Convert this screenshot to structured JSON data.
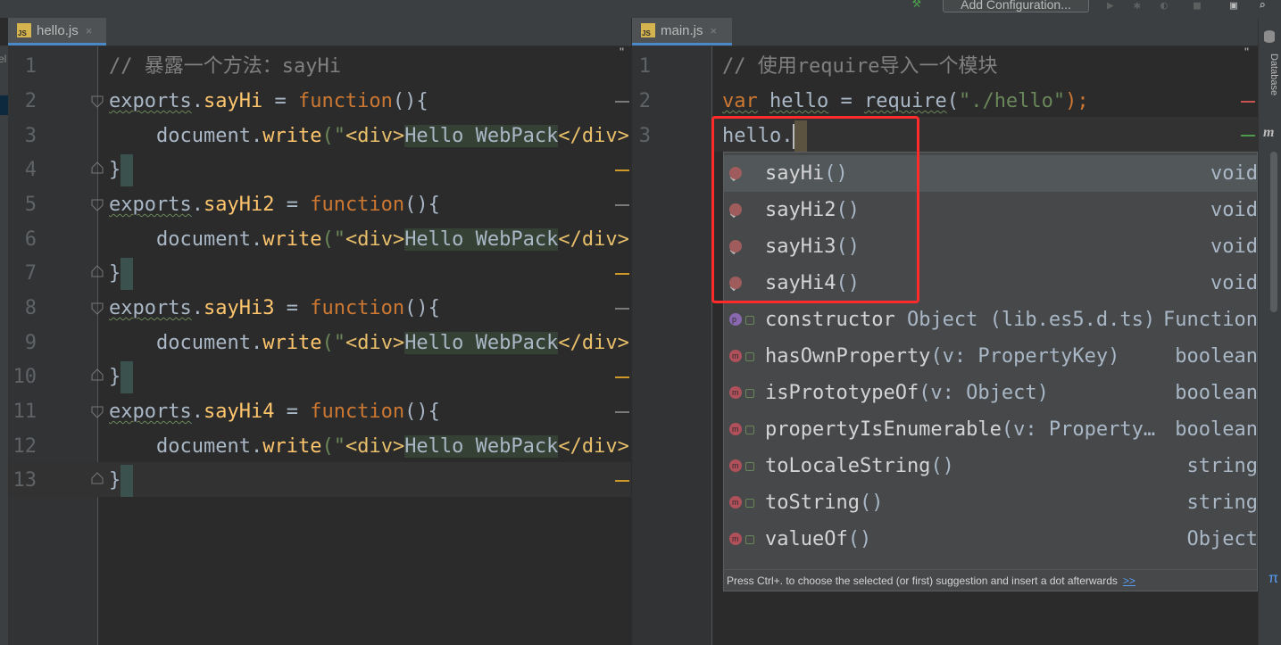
{
  "toolbar": {
    "add_configuration_label": "Add Configuration..."
  },
  "left_panel": {
    "label": "el"
  },
  "left_editor": {
    "tab": {
      "label": "hello.js",
      "icon": "js-file-icon",
      "close": "×"
    },
    "line_numbers": [
      "1",
      "2",
      "3",
      "4",
      "5",
      "6",
      "7",
      "8",
      "9",
      "10",
      "11",
      "12",
      "13"
    ],
    "lines": [
      {
        "comment": "// 暴露一个方法：sayHi"
      },
      {
        "obj": "exports",
        "dot": ".",
        "name": "sayHi",
        "eq": " = ",
        "kw": "function",
        "paren": "(){"
      },
      {
        "obj": "document",
        "dot": ".",
        "method": "write",
        "open": "(\"",
        "tag1": "<div>",
        "text": "Hello WebPack",
        "tag2": "</div>",
        "close": "\""
      },
      {
        "brace": "}"
      },
      {
        "obj": "exports",
        "dot": ".",
        "name": "sayHi2",
        "eq": " = ",
        "kw": "function",
        "paren": "(){"
      },
      {
        "obj": "document",
        "dot": ".",
        "method": "write",
        "open": "(\"",
        "tag1": "<div>",
        "text": "Hello WebPack",
        "tag2": "</div>",
        "close": "\""
      },
      {
        "brace": "}"
      },
      {
        "obj": "exports",
        "dot": ".",
        "name": "sayHi3",
        "eq": " = ",
        "kw": "function",
        "paren": "(){"
      },
      {
        "obj": "document",
        "dot": ".",
        "method": "write",
        "open": "(\"",
        "tag1": "<div>",
        "text": "Hello WebPack",
        "tag2": "</div>",
        "close": "\""
      },
      {
        "brace": "}"
      },
      {
        "obj": "exports",
        "dot": ".",
        "name": "sayHi4",
        "eq": " = ",
        "kw": "function",
        "paren": "(){"
      },
      {
        "obj": "document",
        "dot": ".",
        "method": "write",
        "open": "(\"",
        "tag1": "<div>",
        "text": "Hello WebPack",
        "tag2": "</div>",
        "close": "\""
      },
      {
        "brace": "}"
      }
    ]
  },
  "right_editor": {
    "tab": {
      "label": "main.js",
      "icon": "js-file-icon",
      "close": "×"
    },
    "line_numbers": [
      "1",
      "2",
      "3"
    ],
    "line1": "// 使用require导入一个模块",
    "line2": {
      "kw": "var",
      "sp": " ",
      "var": "hello",
      "eq": " = ",
      "fn": "require",
      "open": "(",
      "str": "\"./hello\"",
      "close": ");"
    },
    "line3": "hello."
  },
  "sidebar_right": {
    "database_label": "Database",
    "m_label": "m"
  },
  "completion": {
    "items": [
      {
        "name": "sayHi",
        "params": "()",
        "type": "void",
        "icon": "export-icon",
        "selected": true
      },
      {
        "name": "sayHi2",
        "params": "()",
        "type": "void",
        "icon": "export-icon",
        "selected": false
      },
      {
        "name": "sayHi3",
        "params": "()",
        "type": "void",
        "icon": "export-icon",
        "selected": false
      },
      {
        "name": "sayHi4",
        "params": "()",
        "type": "void",
        "icon": "export-icon",
        "selected": false
      },
      {
        "name": "constructor",
        "params": " Object (lib.es5.d.ts)",
        "type": "Function",
        "icon": "property-icon",
        "badge": "p"
      },
      {
        "name": "hasOwnProperty",
        "params": "(v: PropertyKey)",
        "type": "boolean",
        "icon": "method-icon",
        "badge": "m"
      },
      {
        "name": "isPrototypeOf",
        "params": "(v: Object)",
        "type": "boolean",
        "icon": "method-icon",
        "badge": "m"
      },
      {
        "name": "propertyIsEnumerable",
        "params": "(v: Property…",
        "type": "boolean",
        "icon": "method-icon",
        "badge": "m"
      },
      {
        "name": "toLocaleString",
        "params": "()",
        "type": "string",
        "icon": "method-icon",
        "badge": "m"
      },
      {
        "name": "toString",
        "params": "()",
        "type": "string",
        "icon": "method-icon",
        "badge": "m"
      },
      {
        "name": "valueOf",
        "params": "()",
        "type": "Object",
        "icon": "method-icon",
        "badge": "m"
      }
    ],
    "footer": "Press Ctrl+. to choose the selected (or first) suggestion and insert a dot afterwards",
    "footer_link": ">>",
    "footer_pi": "π"
  },
  "colors": {
    "background": "#2b2b2b",
    "keyword": "#cc7832",
    "function": "#ffc66d",
    "string": "#6a8759",
    "comment": "#808080",
    "annotation_box": "#ff2a2a"
  }
}
